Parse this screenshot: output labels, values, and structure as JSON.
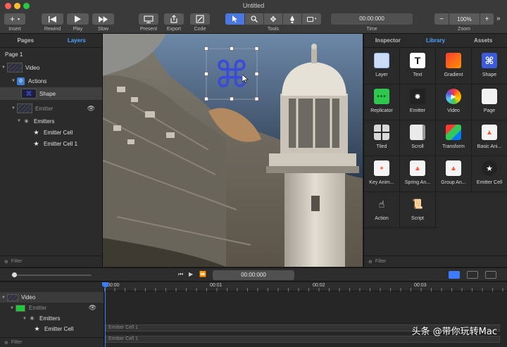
{
  "window": {
    "title": "Untitled"
  },
  "toolbar": {
    "insert": "Insert",
    "rewind": "Rewind",
    "play": "Play",
    "slow": "Slow",
    "present": "Present",
    "export": "Export",
    "code": "Code",
    "tools": "Tools",
    "time_value": "00:00:000",
    "time_label": "Time",
    "zoom_value": "100%",
    "zoom_label": "Zoom"
  },
  "left_panel": {
    "tabs": [
      "Pages",
      "Layers"
    ],
    "active_tab": "Layers",
    "page": "Page 1",
    "layers": [
      {
        "label": "Video"
      },
      {
        "label": "Actions"
      },
      {
        "label": "Shape"
      },
      {
        "label": "Emitter"
      },
      {
        "label": "Emitters"
      },
      {
        "label": "Emitter Cell"
      },
      {
        "label": "Emitter Cell 1"
      }
    ],
    "filter_placeholder": "Filter"
  },
  "right_panel": {
    "tabs": [
      "Inspector",
      "Library",
      "Assets"
    ],
    "active_tab": "Library",
    "library": [
      {
        "label": "Layer",
        "icon": "layer-icon"
      },
      {
        "label": "Text",
        "icon": "text-icon"
      },
      {
        "label": "Gradient",
        "icon": "gradient-icon"
      },
      {
        "label": "Shape",
        "icon": "shape-icon"
      },
      {
        "label": "Replicator",
        "icon": "replicator-icon"
      },
      {
        "label": "Emitter",
        "icon": "emitter-icon"
      },
      {
        "label": "Video",
        "icon": "video-icon"
      },
      {
        "label": "Page",
        "icon": "page-icon"
      },
      {
        "label": "Tiled",
        "icon": "tiled-icon"
      },
      {
        "label": "Scroll",
        "icon": "scroll-icon"
      },
      {
        "label": "Transform",
        "icon": "transform-icon"
      },
      {
        "label": "Basic Ani...",
        "icon": "basic-animation-icon"
      },
      {
        "label": "Key Anim...",
        "icon": "keyframe-animation-icon"
      },
      {
        "label": "Spring An...",
        "icon": "spring-animation-icon"
      },
      {
        "label": "Group An...",
        "icon": "group-animation-icon"
      },
      {
        "label": "Emitter Cell",
        "icon": "emitter-cell-icon"
      },
      {
        "label": "Action",
        "icon": "action-icon"
      },
      {
        "label": "Script",
        "icon": "script-icon"
      }
    ],
    "filter_placeholder": "Filter"
  },
  "transport": {
    "time": "00:00:000"
  },
  "timeline": {
    "ruler": [
      "00:00",
      "00:01",
      "00:02",
      "00:03"
    ],
    "rows": [
      {
        "label": "Video"
      },
      {
        "label": "Emitter"
      },
      {
        "label": "Emitters"
      },
      {
        "label": "Emitter Cell"
      }
    ],
    "tracks": [
      "Emitter Cell 1",
      "Emitter Cell 1"
    ],
    "filter_placeholder": "Filter"
  },
  "watermark": "头条 @带你玩转Mac",
  "colors": {
    "accent": "#4fa3ff",
    "selection": "#3d7cff",
    "close": "#ff5f57",
    "minimize": "#febc2e",
    "zoom": "#28c840"
  }
}
